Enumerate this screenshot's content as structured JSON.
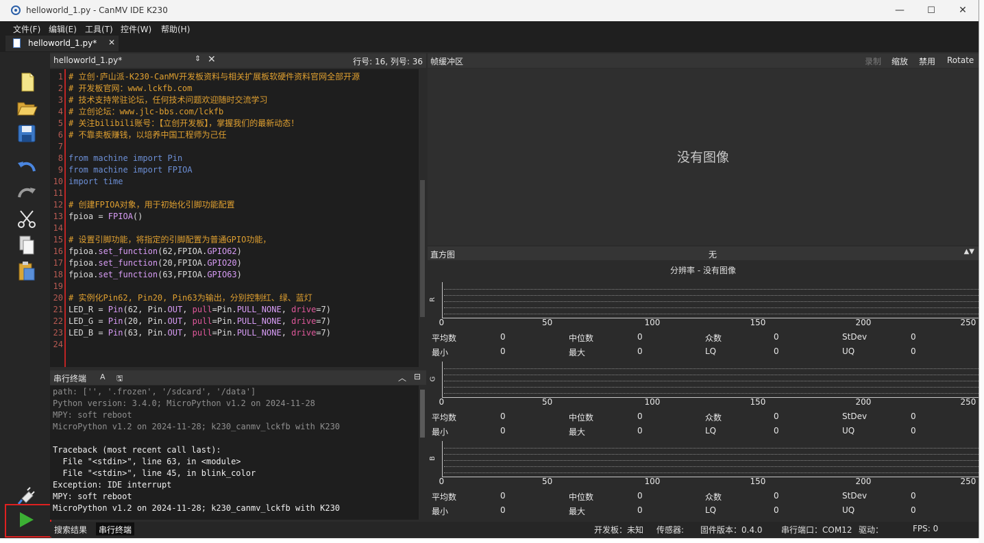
{
  "window": {
    "title": "helloworld_1.py - CanMV IDE K230",
    "controls": {
      "minimize": "—",
      "maximize": "☐",
      "close": "✕"
    }
  },
  "menu": [
    "文件(F)",
    "编辑(E)",
    "工具(T)",
    "控件(W)",
    "帮助(H)"
  ],
  "file_tab": {
    "label": "helloworld_1.py*",
    "close": "✕"
  },
  "toolbar": [
    "new-file-icon",
    "open-folder-icon",
    "save-icon",
    "undo-icon",
    "redo-icon",
    "cut-icon",
    "copy-icon",
    "paste-icon",
    "connect-plug-icon",
    "run-icon"
  ],
  "editor": {
    "filename": "helloworld_1.py*",
    "position": "行号: 16, 列号: 36",
    "lines": [
      {
        "n": "1",
        "parts": [
          [
            "cm",
            "# 立创·庐山派-K230-CanMV开发板资料与相关扩展板软硬件资料官网全部开源"
          ]
        ]
      },
      {
        "n": "2",
        "parts": [
          [
            "cm",
            "# 开发板官网：www.lckfb.com"
          ]
        ]
      },
      {
        "n": "3",
        "parts": [
          [
            "cm",
            "# 技术支持常驻论坛，任何技术问题欢迎随时交流学习"
          ]
        ]
      },
      {
        "n": "4",
        "parts": [
          [
            "cm",
            "# 立创论坛：www.jlc-bbs.com/lckfb"
          ]
        ]
      },
      {
        "n": "5",
        "parts": [
          [
            "cm",
            "# 关注bilibili账号：【立创开发板】，掌握我们的最新动态！"
          ]
        ]
      },
      {
        "n": "6",
        "parts": [
          [
            "cm",
            "# 不靠卖板赚钱，以培养中国工程师为己任"
          ]
        ]
      },
      {
        "n": "7",
        "parts": []
      },
      {
        "n": "8",
        "parts": [
          [
            "kw",
            "from "
          ],
          [
            "mod",
            "machine "
          ],
          [
            "kw",
            "import "
          ],
          [
            "mod",
            "Pin"
          ]
        ]
      },
      {
        "n": "9",
        "parts": [
          [
            "kw",
            "from "
          ],
          [
            "mod",
            "machine "
          ],
          [
            "kw",
            "import "
          ],
          [
            "mod",
            "FPIOA"
          ]
        ]
      },
      {
        "n": "10",
        "parts": [
          [
            "kw",
            "import "
          ],
          [
            "mod",
            "time"
          ]
        ]
      },
      {
        "n": "11",
        "parts": []
      },
      {
        "n": "12",
        "parts": [
          [
            "cm",
            "# 创建FPIOA对象，用于初始化引脚功能配置"
          ]
        ]
      },
      {
        "n": "13",
        "parts": [
          [
            "op",
            "fpioa = "
          ],
          [
            "fn",
            "FPIOA"
          ],
          [
            "op",
            "()"
          ]
        ]
      },
      {
        "n": "14",
        "parts": []
      },
      {
        "n": "15",
        "parts": [
          [
            "cm",
            "# 设置引脚功能，将指定的引脚配置为普通GPIO功能，"
          ]
        ]
      },
      {
        "n": "16",
        "parts": [
          [
            "op",
            "fpioa."
          ],
          [
            "fn",
            "set_function"
          ],
          [
            "op",
            "(62,FPIOA."
          ],
          [
            "fn",
            "GPIO62"
          ],
          [
            "op",
            ")"
          ]
        ]
      },
      {
        "n": "17",
        "parts": [
          [
            "op",
            "fpioa."
          ],
          [
            "fn",
            "set_function"
          ],
          [
            "op",
            "(20,FPIOA."
          ],
          [
            "fn",
            "GPIO20"
          ],
          [
            "op",
            ")"
          ]
        ]
      },
      {
        "n": "18",
        "parts": [
          [
            "op",
            "fpioa."
          ],
          [
            "fn",
            "set_function"
          ],
          [
            "op",
            "(63,FPIOA."
          ],
          [
            "fn",
            "GPIO63"
          ],
          [
            "op",
            ")"
          ]
        ]
      },
      {
        "n": "19",
        "parts": []
      },
      {
        "n": "20",
        "parts": [
          [
            "cm",
            "# 实例化Pin62, Pin20, Pin63为输出，分别控制红、绿、蓝灯"
          ]
        ]
      },
      {
        "n": "21",
        "parts": [
          [
            "op",
            "LED_R = "
          ],
          [
            "fn",
            "Pin"
          ],
          [
            "op",
            "(62, Pin."
          ],
          [
            "fn",
            "OUT"
          ],
          [
            "op",
            ", "
          ],
          [
            "kwarg",
            "pull"
          ],
          [
            "op",
            "=Pin."
          ],
          [
            "fn",
            "PULL_NONE"
          ],
          [
            "op",
            ", "
          ],
          [
            "kwarg",
            "drive"
          ],
          [
            "op",
            "=7)"
          ]
        ]
      },
      {
        "n": "22",
        "parts": [
          [
            "op",
            "LED_G = "
          ],
          [
            "fn",
            "Pin"
          ],
          [
            "op",
            "(20, Pin."
          ],
          [
            "fn",
            "OUT"
          ],
          [
            "op",
            ", "
          ],
          [
            "kwarg",
            "pull"
          ],
          [
            "op",
            "=Pin."
          ],
          [
            "fn",
            "PULL_NONE"
          ],
          [
            "op",
            ", "
          ],
          [
            "kwarg",
            "drive"
          ],
          [
            "op",
            "=7)"
          ]
        ]
      },
      {
        "n": "23",
        "parts": [
          [
            "op",
            "LED_B = "
          ],
          [
            "fn",
            "Pin"
          ],
          [
            "op",
            "(63, Pin."
          ],
          [
            "fn",
            "OUT"
          ],
          [
            "op",
            ", "
          ],
          [
            "kwarg",
            "pull"
          ],
          [
            "op",
            "=Pin."
          ],
          [
            "fn",
            "PULL_NONE"
          ],
          [
            "op",
            ", "
          ],
          [
            "kwarg",
            "drive"
          ],
          [
            "op",
            "=7)"
          ]
        ]
      },
      {
        "n": "24",
        "parts": []
      }
    ]
  },
  "terminal": {
    "title": "串行终端",
    "lines": [
      {
        "t": "path: ['', '.frozen', '/sdcard', '/data']",
        "b": false
      },
      {
        "t": "Python version: 3.4.0; MicroPython v1.2 on 2024-11-28",
        "b": false
      },
      {
        "t": "MPY: soft reboot",
        "b": false
      },
      {
        "t": "MicroPython v1.2 on 2024-11-28; k230_canmv_lckfb with K230",
        "b": false
      },
      {
        "t": "",
        "b": false
      },
      {
        "t": "Traceback (most recent call last):",
        "b": true
      },
      {
        "t": "  File \"<stdin>\", line 63, in <module>",
        "b": true
      },
      {
        "t": "  File \"<stdin>\", line 45, in blink_color",
        "b": true
      },
      {
        "t": "Exception: IDE interrupt",
        "b": true
      },
      {
        "t": "MPY: soft reboot",
        "b": true
      },
      {
        "t": "MicroPython v1.2 on 2024-11-28; k230_canmv_lckfb with K230",
        "b": true
      }
    ]
  },
  "bottom_tabs": [
    "搜索结果",
    "串行终端"
  ],
  "status": {
    "board": "开发板：未知",
    "sensor": "传感器:",
    "firmware": "固件版本：0.4.0",
    "port": "串行端口：COM12",
    "driver": "驱动：",
    "fps": "FPS: 0"
  },
  "framebuffer": {
    "title": "帧缓冲区",
    "buttons": [
      "录制",
      "缩放",
      "禁用",
      "Rotate"
    ],
    "no_image": "没有图像"
  },
  "histogram": {
    "title": "直方图",
    "mode": "无",
    "resolution": "分辨率 - 没有图像",
    "ticks": [
      "0",
      "50",
      "100",
      "150",
      "200",
      "250"
    ],
    "channels": [
      {
        "name": "R",
        "stats": [
          [
            "平均数",
            "0"
          ],
          [
            "中位数",
            "0"
          ],
          [
            "众数",
            "0"
          ],
          [
            "StDev",
            "0"
          ],
          [
            "最小",
            "0"
          ],
          [
            "最大",
            "0"
          ],
          [
            "LQ",
            "0"
          ],
          [
            "UQ",
            "0"
          ]
        ]
      },
      {
        "name": "G",
        "stats": [
          [
            "平均数",
            "0"
          ],
          [
            "中位数",
            "0"
          ],
          [
            "众数",
            "0"
          ],
          [
            "StDev",
            "0"
          ],
          [
            "最小",
            "0"
          ],
          [
            "最大",
            "0"
          ],
          [
            "LQ",
            "0"
          ],
          [
            "UQ",
            "0"
          ]
        ]
      },
      {
        "name": "B",
        "stats": [
          [
            "平均数",
            "0"
          ],
          [
            "中位数",
            "0"
          ],
          [
            "众数",
            "0"
          ],
          [
            "StDev",
            "0"
          ],
          [
            "最小",
            "0"
          ],
          [
            "最大",
            "0"
          ],
          [
            "LQ",
            "0"
          ],
          [
            "UQ",
            "0"
          ]
        ]
      }
    ]
  }
}
